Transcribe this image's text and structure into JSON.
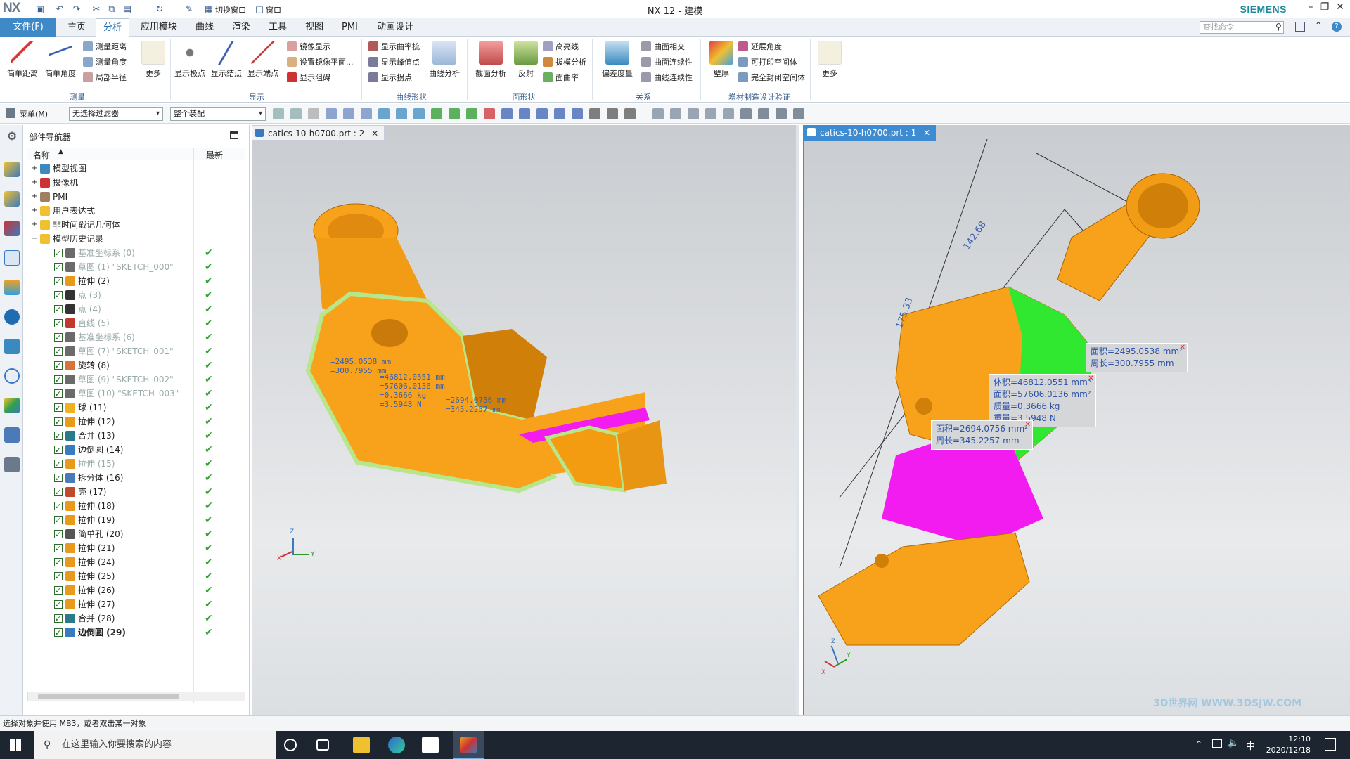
{
  "window": {
    "app_logo": "NX",
    "title": "NX 12 - 建模",
    "brand": "SIEMENS",
    "qa_toggle": "切换窗口",
    "qa_window": "窗口",
    "minimize": "–",
    "restore": "❐",
    "close": "✕"
  },
  "menu": {
    "file": "文件(F)",
    "tabs": [
      "主页",
      "分析",
      "应用模块",
      "曲线",
      "渲染",
      "工具",
      "视图",
      "PMI",
      "动画设计"
    ],
    "active_tab": "分析",
    "search_placeholder": "查找命令"
  },
  "ribbon": {
    "groups": [
      "测量",
      "显示",
      "曲线形状",
      "面形状",
      "关系",
      "增材制造设计验证"
    ],
    "measure": {
      "big": [
        "简单距离",
        "简单角度"
      ],
      "small": [
        "测量距离",
        "测量角度",
        "局部半径"
      ],
      "more": "更多"
    },
    "display": {
      "big": [
        "显示极点",
        "显示结点",
        "显示端点"
      ],
      "small": [
        "镜像显示",
        "设置镜像平面...",
        "显示阻碍"
      ]
    },
    "curve_shape": {
      "small": [
        "显示曲率梳",
        "显示峰值点",
        "显示拐点"
      ],
      "big": [
        "曲线分析"
      ]
    },
    "face_shape": {
      "big": [
        "截面分析",
        "反射"
      ],
      "small": [
        "高亮线",
        "拔模分析",
        "面曲率"
      ]
    },
    "relation": {
      "big": [
        "偏差度量"
      ],
      "small": [
        "曲面相交",
        "曲面连续性",
        "曲线连续性"
      ]
    },
    "am": {
      "big": [
        "壁厚"
      ],
      "small": [
        "延展角度",
        "可打印空间体",
        "完全封闭空间体"
      ],
      "more": "更多"
    }
  },
  "selection_bar": {
    "menu": "菜单(M)",
    "filter": "无选择过滤器",
    "scope": "整个装配"
  },
  "navigator": {
    "title": "部件导航器",
    "col_name": "名称",
    "col_latest": "最新",
    "groups": [
      "模型视图",
      "摄像机",
      "PMI",
      "用户表达式",
      "非时间戳记几何体",
      "模型历史记录"
    ],
    "features": [
      {
        "label": "基准坐标系 (0)",
        "disabled": true,
        "icon": "csys-icon",
        "color": "#6b6b6b"
      },
      {
        "label": "草图 (1) \"SKETCH_000\"",
        "disabled": true,
        "icon": "sketch-icon",
        "color": "#6b6b6b"
      },
      {
        "label": "拉伸 (2)",
        "disabled": false,
        "icon": "extrude-icon",
        "color": "#e89a1c"
      },
      {
        "label": "点 (3)",
        "disabled": true,
        "icon": "point-icon",
        "color": "#333333"
      },
      {
        "label": "点 (4)",
        "disabled": true,
        "icon": "point-icon",
        "color": "#333333"
      },
      {
        "label": "直线 (5)",
        "disabled": true,
        "icon": "line-icon",
        "color": "#c0392b"
      },
      {
        "label": "基准坐标系 (6)",
        "disabled": true,
        "icon": "csys-icon",
        "color": "#6b6b6b"
      },
      {
        "label": "草图 (7) \"SKETCH_001\"",
        "disabled": true,
        "icon": "sketch-icon",
        "color": "#6b6b6b"
      },
      {
        "label": "旋转 (8)",
        "disabled": false,
        "icon": "revolve-icon",
        "color": "#d8743a"
      },
      {
        "label": "草图 (9) \"SKETCH_002\"",
        "disabled": true,
        "icon": "sketch-icon",
        "color": "#6b6b6b"
      },
      {
        "label": "草图 (10) \"SKETCH_003\"",
        "disabled": true,
        "icon": "sketch-icon",
        "color": "#6b6b6b"
      },
      {
        "label": "球 (11)",
        "disabled": false,
        "icon": "sphere-icon",
        "color": "#f0b020"
      },
      {
        "label": "拉伸 (12)",
        "disabled": false,
        "icon": "extrude-icon",
        "color": "#e89a1c"
      },
      {
        "label": "合并 (13)",
        "disabled": false,
        "icon": "unite-icon",
        "color": "#2a7a8a"
      },
      {
        "label": "边倒圆 (14)",
        "disabled": false,
        "icon": "blend-icon",
        "color": "#3a7ac0"
      },
      {
        "label": "拉伸 (15)",
        "disabled": true,
        "icon": "extrude-icon",
        "color": "#e89a1c"
      },
      {
        "label": "拆分体 (16)",
        "disabled": false,
        "icon": "split-icon",
        "color": "#4a7ab8"
      },
      {
        "label": "壳 (17)",
        "disabled": false,
        "icon": "shell-icon",
        "color": "#c04a2a"
      },
      {
        "label": "拉伸 (18)",
        "disabled": false,
        "icon": "extrude-icon",
        "color": "#e89a1c"
      },
      {
        "label": "拉伸 (19)",
        "disabled": false,
        "icon": "extrude-icon",
        "color": "#e89a1c"
      },
      {
        "label": "简单孔 (20)",
        "disabled": false,
        "icon": "hole-icon",
        "color": "#555555"
      },
      {
        "label": "拉伸 (21)",
        "disabled": false,
        "icon": "extrude-icon",
        "color": "#e89a1c"
      },
      {
        "label": "拉伸 (24)",
        "disabled": false,
        "icon": "extrude-icon",
        "color": "#e89a1c"
      },
      {
        "label": "拉伸 (25)",
        "disabled": false,
        "icon": "extrude-icon",
        "color": "#e89a1c"
      },
      {
        "label": "拉伸 (26)",
        "disabled": false,
        "icon": "extrude-icon",
        "color": "#e89a1c"
      },
      {
        "label": "拉伸 (27)",
        "disabled": false,
        "icon": "extrude-icon",
        "color": "#e89a1c"
      },
      {
        "label": "合并 (28)",
        "disabled": false,
        "icon": "unite-icon",
        "color": "#2a7a8a"
      },
      {
        "label": "边倒圆 (29)",
        "disabled": false,
        "icon": "blend-icon",
        "color": "#3a7ac0",
        "bold": true
      }
    ],
    "latest_mark": "✔"
  },
  "viewport1": {
    "tab": "catics-10-h0700.prt : 2",
    "meas_a": "=2495.0538 mm\n=300.7955 mm",
    "meas_b": "=46812.0551 mm\n=57606.0136 mm\n=0.3666 kg\n=3.5948 N",
    "meas_c": "=2694.0756 mm\n=345.2257 mm",
    "axis": {
      "x": "X",
      "y": "Y",
      "z": "Z"
    }
  },
  "viewport2": {
    "tab": "catics-10-h0700.prt : 1",
    "dim1": "175.33",
    "dim2": "142.68",
    "area1": [
      "面积=2495.0538 mm²",
      "周长=300.7955 mm"
    ],
    "mass": [
      "体积=46812.0551 mm³",
      "面积=57606.0136 mm²",
      "质量=0.3666 kg",
      "重量=3.5948 N"
    ],
    "area2": [
      "面积=2694.0756 mm²",
      "周长=345.2257 mm"
    ],
    "axis": {
      "x": "X",
      "y": "Y",
      "z": "Z"
    }
  },
  "status": "选择对象并使用 MB3，或者双击某一对象",
  "taskbar": {
    "search": "在这里输入你要搜索的内容",
    "time": "12:10",
    "date": "2020/12/18",
    "ime": "中"
  },
  "watermark": "3D世界网 WWW.3DSJW.COM",
  "colors": {
    "accent": "#3f89c7",
    "part_orange": "#f7a21a",
    "part_dark": "#c87a08",
    "face_green": "#2fe82f",
    "face_magenta": "#f21cf0",
    "outline_green": "#b8e68a",
    "measure_blue": "#3a5fb0"
  }
}
